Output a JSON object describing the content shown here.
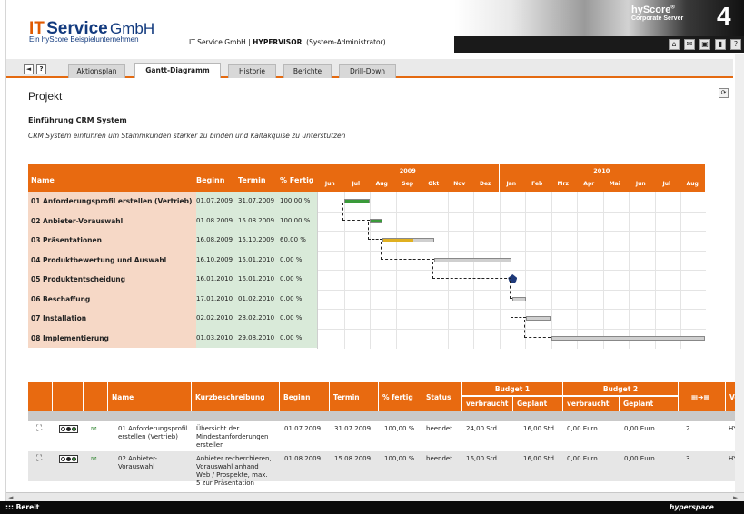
{
  "header": {
    "brand_it": "IT",
    "brand_service": "Service",
    "brand_gmbh": "GmbH",
    "brand_sub": "Ein hyScore Beispielunternehmen",
    "company_prefix": "IT Service GmbH |",
    "module": "HYPERVISOR",
    "user": "(System-Administrator)",
    "product": "hyScore",
    "product_reg": "®",
    "product_sub": "Corporate Server",
    "version_glyph": "4"
  },
  "toolbar_icons": [
    "home-icon",
    "mail-icon",
    "window-icon",
    "book-icon",
    "help-icon"
  ],
  "tabs": {
    "back": "◄",
    "help": "?",
    "items": [
      {
        "label": "Aktionsplan"
      },
      {
        "label": "Gantt-Diagramm"
      },
      {
        "label": "Historie"
      },
      {
        "label": "Berichte"
      },
      {
        "label": "Drill-Down"
      }
    ]
  },
  "page": {
    "title": "Projekt",
    "project_name": "Einführung CRM System",
    "project_description": "CRM System einführen um Stammkunden stärker zu binden und Kaltakquise zu unterstützen"
  },
  "gantt": {
    "headers": {
      "name": "Name",
      "beginn": "Beginn",
      "termin": "Termin",
      "fertig": "% Fertig"
    },
    "years": [
      "2009",
      "2010"
    ],
    "months": [
      "Jun",
      "Jul",
      "Aug",
      "Sep",
      "Okt",
      "Nov",
      "Dez",
      "Jan",
      "Feb",
      "Mrz",
      "Apr",
      "Mai",
      "Jun",
      "Jul",
      "Aug"
    ],
    "rows": [
      {
        "name": "01 Anforderungsprofil erstellen (Vertrieb)",
        "beginn": "01.07.2009",
        "termin": "31.07.2009",
        "fertig": "100.00 %",
        "progress": 1.0
      },
      {
        "name": "02 Anbieter-Vorauswahl",
        "beginn": "01.08.2009",
        "termin": "15.08.2009",
        "fertig": "100.00 %",
        "progress": 1.0
      },
      {
        "name": "03 Präsentationen",
        "beginn": "16.08.2009",
        "termin": "15.10.2009",
        "fertig": "60.00 %",
        "progress": 0.6
      },
      {
        "name": "04 Produktbewertung und Auswahl",
        "beginn": "16.10.2009",
        "termin": "15.01.2010",
        "fertig": "0.00 %",
        "progress": 0.0
      },
      {
        "name": "05 Produktentscheidung",
        "beginn": "16.01.2010",
        "termin": "16.01.2010",
        "fertig": "0.00 %",
        "progress": 0.0,
        "milestone": true
      },
      {
        "name": "06 Beschaffung",
        "beginn": "17.01.2010",
        "termin": "01.02.2010",
        "fertig": "0.00 %",
        "progress": 0.0
      },
      {
        "name": "07 Installation",
        "beginn": "02.02.2010",
        "termin": "28.02.2010",
        "fertig": "0.00 %",
        "progress": 0.0
      },
      {
        "name": "08 Implementierung",
        "beginn": "01.03.2010",
        "termin": "29.08.2010",
        "fertig": "0.00 %",
        "progress": 0.0
      }
    ]
  },
  "table": {
    "headers": {
      "name": "Name",
      "kurzbeschreibung": "Kurzbeschreibung",
      "beginn": "Beginn",
      "termin": "Termin",
      "fertig": "% fertig",
      "status": "Status",
      "budget1": "Budget 1",
      "budget2": "Budget 2",
      "verbraucht": "verbraucht",
      "geplant": "Geplant",
      "ve": "Ve"
    },
    "rows": [
      {
        "name": "01 Anforderungsprofil erstellen (Vertrieb)",
        "desc": "Übersicht der Mindestanforderungen erstellen",
        "beginn": "01.07.2009",
        "termin": "31.07.2009",
        "fertig": "100,00 %",
        "status": "beendet",
        "b1v": "24,00 Std.",
        "b1g": "16,00 Std.",
        "b2v": "0,00 Euro",
        "b2g": "0,00 Euro",
        "num": "2",
        "ve": "HYF"
      },
      {
        "name": "02 Anbieter-Vorauswahl",
        "desc": "Anbieter recherchieren, Vorauswahl anhand Web / Prospekte, max. 5 zur Präsentation",
        "beginn": "01.08.2009",
        "termin": "15.08.2009",
        "fertig": "100,00 %",
        "status": "beendet",
        "b1v": "16,00 Std.",
        "b1g": "16,00 Std.",
        "b2v": "0,00 Euro",
        "b2g": "0,00 Euro",
        "num": "3",
        "ve": "HYF"
      }
    ]
  },
  "statusbar": {
    "left": "::: Bereit",
    "right": "hyperspace"
  },
  "colors": {
    "accent": "#e86a10",
    "done": "#3a9a3a",
    "partial": "#e0b020",
    "milestone": "#1f3a7a"
  }
}
